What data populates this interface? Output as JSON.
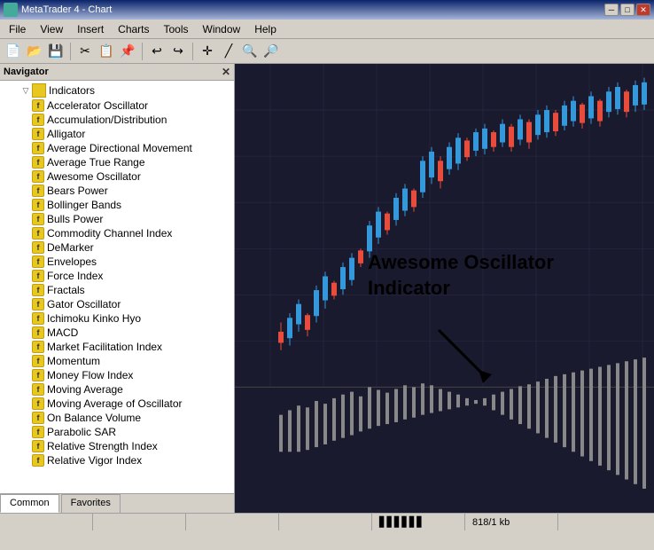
{
  "titleBar": {
    "title": "MetaTrader 4 - Chart",
    "minBtn": "─",
    "maxBtn": "□",
    "closeBtn": "✕"
  },
  "menuBar": {
    "items": [
      "File",
      "View",
      "Insert",
      "Charts",
      "Tools",
      "Window",
      "Help"
    ]
  },
  "navigator": {
    "title": "Navigator",
    "closeBtn": "✕",
    "sections": {
      "indicators": {
        "label": "Indicators",
        "items": [
          "Accelerator Oscillator",
          "Accumulation/Distribution",
          "Alligator",
          "Average Directional Movement",
          "Average True Range",
          "Awesome Oscillator",
          "Bears Power",
          "Bollinger Bands",
          "Bulls Power",
          "Commodity Channel Index",
          "DeMarker",
          "Envelopes",
          "Force Index",
          "Fractals",
          "Gator Oscillator",
          "Ichimoku Kinko Hyo",
          "MACD",
          "Market Facilitation Index",
          "Momentum",
          "Money Flow Index",
          "Moving Average",
          "Moving Average of Oscillator",
          "On Balance Volume",
          "Parabolic SAR",
          "Relative Strength Index",
          "Relative Vigor Index"
        ]
      }
    },
    "tabs": [
      "Common",
      "Favorites"
    ]
  },
  "chart": {
    "annotation": {
      "line1": "Awesome Oscillator",
      "line2": "Indicator"
    }
  },
  "statusBar": {
    "segments": [
      "",
      "",
      "",
      "",
      "▋▋▋▋▋▋",
      "818/1 kb",
      ""
    ]
  }
}
